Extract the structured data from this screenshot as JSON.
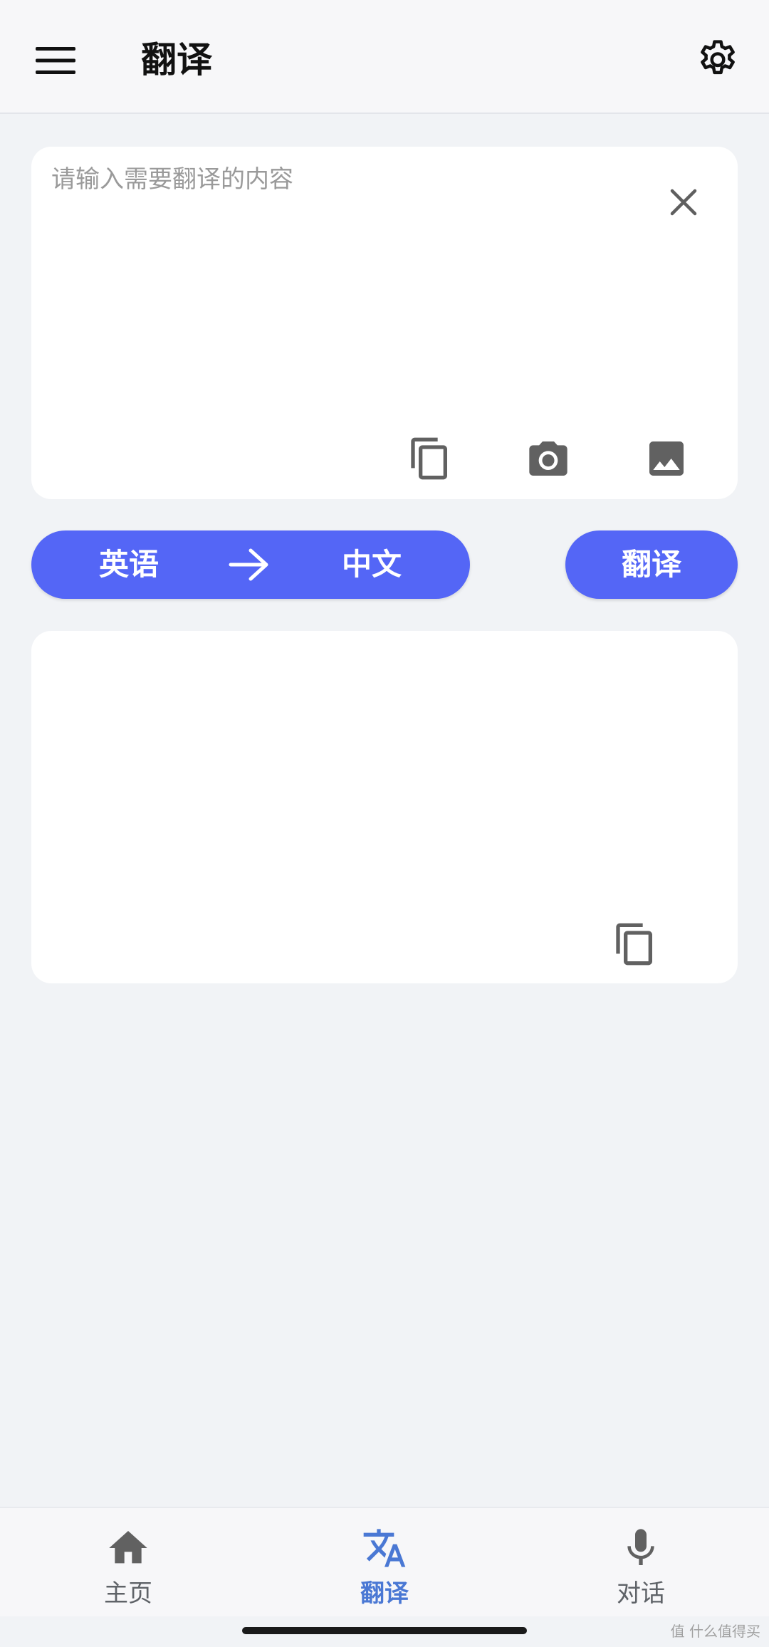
{
  "header": {
    "title": "翻译",
    "menu_icon": "hamburger-menu-icon",
    "settings_icon": "gear-icon"
  },
  "input_card": {
    "placeholder": "请输入需要翻译的内容",
    "value": "",
    "tools": [
      "paste-icon",
      "camera-icon",
      "image-icon"
    ],
    "clear_icon": "close-icon"
  },
  "language_bar": {
    "source": "英语",
    "target": "中文",
    "arrow_icon": "arrow-right-icon",
    "translate_label": "翻译"
  },
  "output_card": {
    "value": "",
    "copy_icon": "copy-icon"
  },
  "bottom_nav": {
    "items": [
      {
        "label": "主页",
        "icon": "home-icon"
      },
      {
        "label": "翻译",
        "icon": "translate-icon",
        "active": true
      },
      {
        "label": "对话",
        "icon": "microphone-icon"
      }
    ]
  },
  "watermark": "值 什么值得买",
  "colors": {
    "accent": "#5466f6",
    "nav_active": "#4a78d4",
    "icon_gray": "#616161",
    "background": "#f1f3f6"
  }
}
